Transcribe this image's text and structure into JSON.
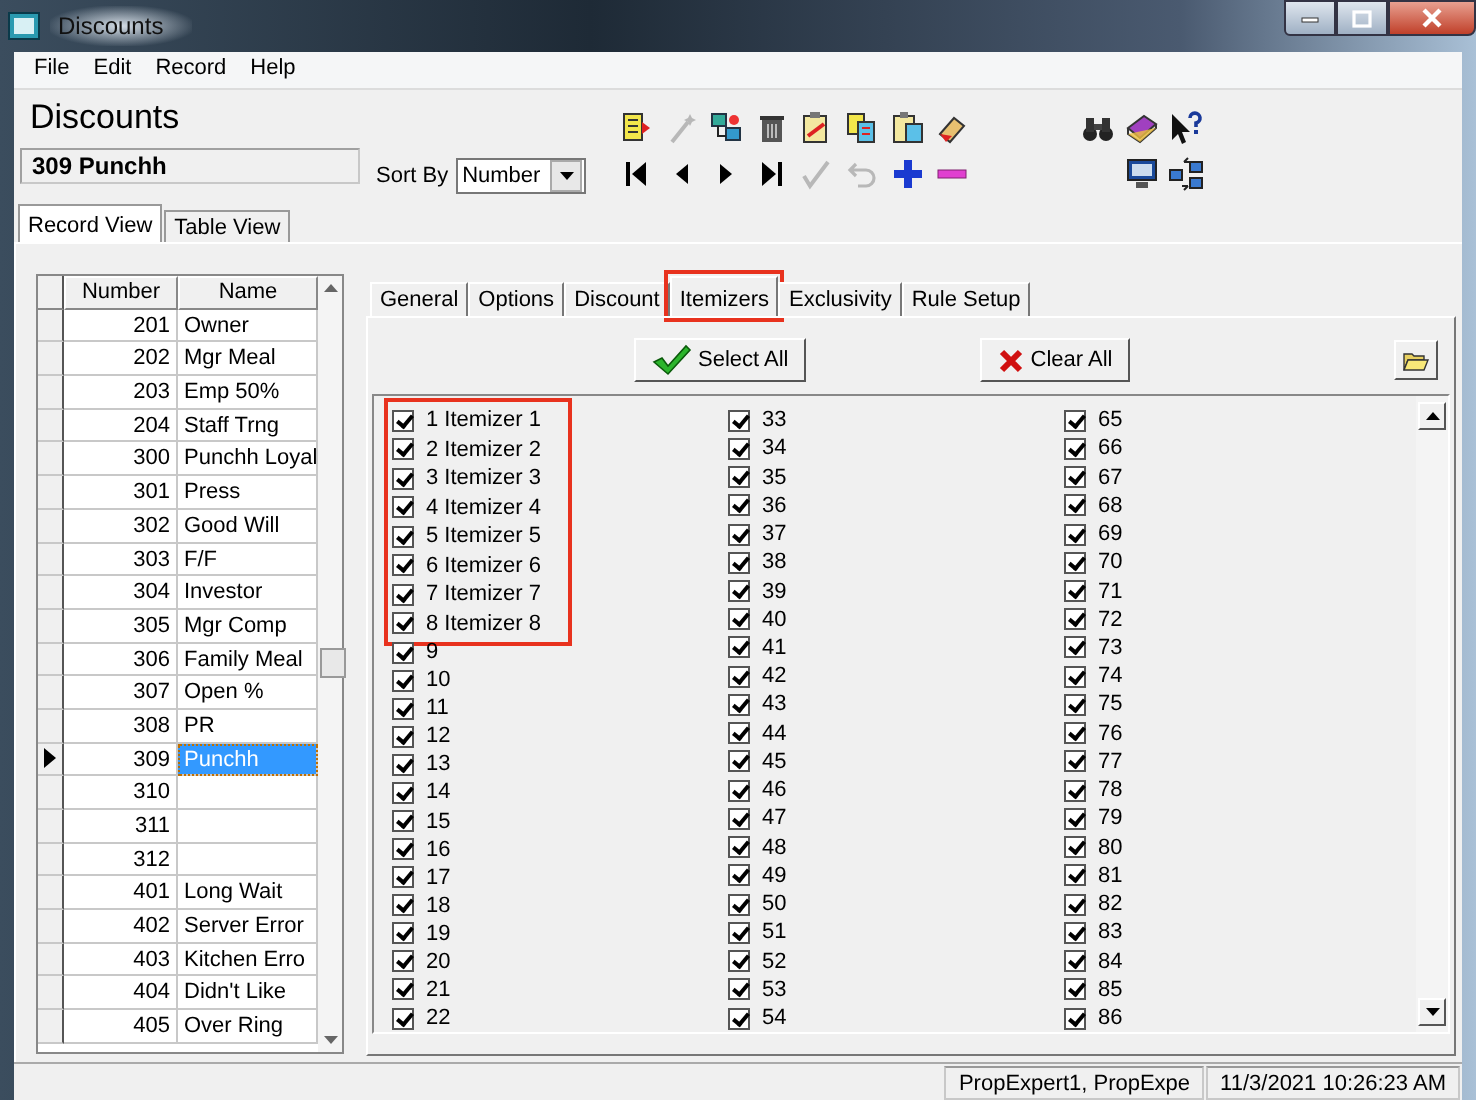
{
  "window": {
    "title": "Discounts"
  },
  "menu": [
    "File",
    "Edit",
    "Record",
    "Help"
  ],
  "form_title": "Discounts",
  "record_field": {
    "value": "309 Punchh"
  },
  "sort_by": {
    "label": "Sort By",
    "value": "Number"
  },
  "toolbar_top": [
    {
      "kind": "doc-new",
      "disabled": false
    },
    {
      "kind": "wand",
      "disabled": true
    },
    {
      "kind": "network",
      "disabled": false
    },
    {
      "kind": "trash",
      "disabled": false
    },
    {
      "kind": "clipboard",
      "disabled": false
    },
    {
      "kind": "copy",
      "disabled": false
    },
    {
      "kind": "paste",
      "disabled": false
    },
    {
      "kind": "eraser",
      "disabled": false
    }
  ],
  "toolbar_bottom": [
    {
      "kind": "first",
      "disabled": false
    },
    {
      "kind": "prev",
      "disabled": false
    },
    {
      "kind": "next",
      "disabled": false
    },
    {
      "kind": "last",
      "disabled": false
    },
    {
      "kind": "check",
      "disabled": true
    },
    {
      "kind": "undo",
      "disabled": true
    },
    {
      "kind": "plus",
      "disabled": false
    },
    {
      "kind": "minus",
      "disabled": false
    }
  ],
  "toolbar_right_top": [
    {
      "kind": "binoculars",
      "disabled": false
    },
    {
      "kind": "book",
      "disabled": false
    },
    {
      "kind": "help",
      "disabled": false
    }
  ],
  "toolbar_right_bottom": [
    {
      "kind": "monitor",
      "disabled": false
    },
    {
      "kind": "sync",
      "disabled": false
    }
  ],
  "view_tabs": [
    {
      "label": "Record View",
      "selected": true
    },
    {
      "label": "Table View",
      "selected": false
    }
  ],
  "grid": {
    "columns": [
      "Number",
      "Name"
    ],
    "rows": [
      {
        "number": "201",
        "name": "Owner",
        "selected": false
      },
      {
        "number": "202",
        "name": "Mgr Meal",
        "selected": false
      },
      {
        "number": "203",
        "name": "Emp 50%",
        "selected": false
      },
      {
        "number": "204",
        "name": "Staff Trng",
        "selected": false
      },
      {
        "number": "300",
        "name": "Punchh Loyal",
        "selected": false
      },
      {
        "number": "301",
        "name": "Press",
        "selected": false
      },
      {
        "number": "302",
        "name": "Good Will",
        "selected": false
      },
      {
        "number": "303",
        "name": "F/F",
        "selected": false
      },
      {
        "number": "304",
        "name": "Investor",
        "selected": false
      },
      {
        "number": "305",
        "name": "Mgr Comp",
        "selected": false
      },
      {
        "number": "306",
        "name": "Family Meal",
        "selected": false
      },
      {
        "number": "307",
        "name": "Open %",
        "selected": false
      },
      {
        "number": "308",
        "name": "PR",
        "selected": false
      },
      {
        "number": "309",
        "name": "Punchh",
        "selected": true
      },
      {
        "number": "310",
        "selected": false
      },
      {
        "number": "311",
        "selected": false
      },
      {
        "number": "312",
        "selected": false
      },
      {
        "number": "401",
        "name": "Long Wait",
        "selected": false
      },
      {
        "number": "402",
        "name": "Server Error",
        "selected": false
      },
      {
        "number": "403",
        "name": "Kitchen Erro",
        "selected": false
      },
      {
        "number": "404",
        "name": "Didn't Like",
        "selected": false
      },
      {
        "number": "405",
        "name": "Over Ring",
        "selected": false
      }
    ]
  },
  "detail_tabs": [
    {
      "label": "General",
      "selected": false,
      "highlighted": false
    },
    {
      "label": "Options",
      "selected": false,
      "highlighted": false
    },
    {
      "label": "Discount",
      "selected": false,
      "highlighted": false
    },
    {
      "label": "Itemizers",
      "selected": true,
      "highlighted": true
    },
    {
      "label": "Exclusivity",
      "selected": false,
      "highlighted": false
    },
    {
      "label": "Rule Setup",
      "selected": false,
      "highlighted": false
    }
  ],
  "buttons": [
    {
      "kind": "select",
      "label": "Select All"
    },
    {
      "kind": "clear",
      "label": "Clear All"
    }
  ],
  "itemizer_columns": [
    {
      "highlighted_items": [
        {
          "label": "1 Itemizer 1",
          "checked": true
        },
        {
          "label": "2 Itemizer 2",
          "checked": true
        },
        {
          "label": "3 Itemizer 3",
          "checked": true
        },
        {
          "label": "4 Itemizer 4",
          "checked": true
        },
        {
          "label": "5 Itemizer 5",
          "checked": true
        },
        {
          "label": "6 Itemizer 6",
          "checked": true
        },
        {
          "label": "7 Itemizer 7",
          "checked": true
        },
        {
          "label": "8 Itemizer 8",
          "checked": true
        }
      ],
      "items": [
        {
          "label": "9",
          "checked": true
        },
        {
          "label": "10",
          "checked": true
        },
        {
          "label": "11",
          "checked": true
        },
        {
          "label": "12",
          "checked": true
        },
        {
          "label": "13",
          "checked": true
        },
        {
          "label": "14",
          "checked": true
        },
        {
          "label": "15",
          "checked": true
        },
        {
          "label": "16",
          "checked": true
        },
        {
          "label": "17",
          "checked": true
        },
        {
          "label": "18",
          "checked": true
        },
        {
          "label": "19",
          "checked": true
        },
        {
          "label": "20",
          "checked": true
        },
        {
          "label": "21",
          "checked": true
        },
        {
          "label": "22",
          "checked": true
        }
      ]
    },
    {
      "items": [
        {
          "label": "33",
          "checked": true
        },
        {
          "label": "34",
          "checked": true
        },
        {
          "label": "35",
          "checked": true
        },
        {
          "label": "36",
          "checked": true
        },
        {
          "label": "37",
          "checked": true
        },
        {
          "label": "38",
          "checked": true
        },
        {
          "label": "39",
          "checked": true
        },
        {
          "label": "40",
          "checked": true
        },
        {
          "label": "41",
          "checked": true
        },
        {
          "label": "42",
          "checked": true
        },
        {
          "label": "43",
          "checked": true
        },
        {
          "label": "44",
          "checked": true
        },
        {
          "label": "45",
          "checked": true
        },
        {
          "label": "46",
          "checked": true
        },
        {
          "label": "47",
          "checked": true
        },
        {
          "label": "48",
          "checked": true
        },
        {
          "label": "49",
          "checked": true
        },
        {
          "label": "50",
          "checked": true
        },
        {
          "label": "51",
          "checked": true
        },
        {
          "label": "52",
          "checked": true
        },
        {
          "label": "53",
          "checked": true
        },
        {
          "label": "54",
          "checked": true
        }
      ]
    },
    {
      "items": [
        {
          "label": "65",
          "checked": true
        },
        {
          "label": "66",
          "checked": true
        },
        {
          "label": "67",
          "checked": true
        },
        {
          "label": "68",
          "checked": true
        },
        {
          "label": "69",
          "checked": true
        },
        {
          "label": "70",
          "checked": true
        },
        {
          "label": "71",
          "checked": true
        },
        {
          "label": "72",
          "checked": true
        },
        {
          "label": "73",
          "checked": true
        },
        {
          "label": "74",
          "checked": true
        },
        {
          "label": "75",
          "checked": true
        },
        {
          "label": "76",
          "checked": true
        },
        {
          "label": "77",
          "checked": true
        },
        {
          "label": "78",
          "checked": true
        },
        {
          "label": "79",
          "checked": true
        },
        {
          "label": "80",
          "checked": true
        },
        {
          "label": "81",
          "checked": true
        },
        {
          "label": "82",
          "checked": true
        },
        {
          "label": "83",
          "checked": true
        },
        {
          "label": "84",
          "checked": true
        },
        {
          "label": "85",
          "checked": true
        },
        {
          "label": "86",
          "checked": true
        }
      ]
    }
  ],
  "status_bar": [
    "PropExpert1, PropExpe",
    "11/3/2021 10:26:23 AM"
  ]
}
